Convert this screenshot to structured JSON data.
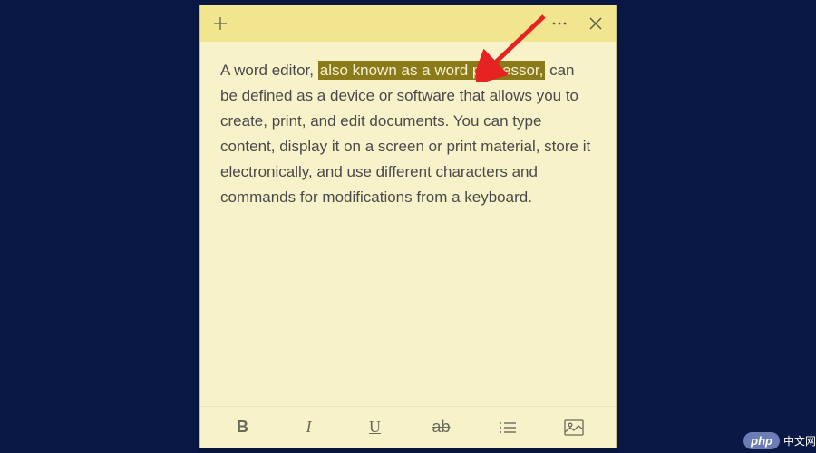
{
  "titlebar": {
    "new_note": "+",
    "menu": "…",
    "close": "×"
  },
  "note": {
    "text_before": "A word editor, ",
    "highlighted": "also known as a word processor,",
    "text_after": " can be defined as a device or software that allows you to create, print, and edit documents. You can type content, display it on a screen or print material, store it electronically, and use different characters and commands for modifications from a keyboard."
  },
  "toolbar": {
    "bold": "B",
    "italic": "I",
    "underline": "U",
    "strike": "ab",
    "list": "list",
    "image": "image"
  },
  "watermark": {
    "badge": "php",
    "site": "中文网"
  }
}
